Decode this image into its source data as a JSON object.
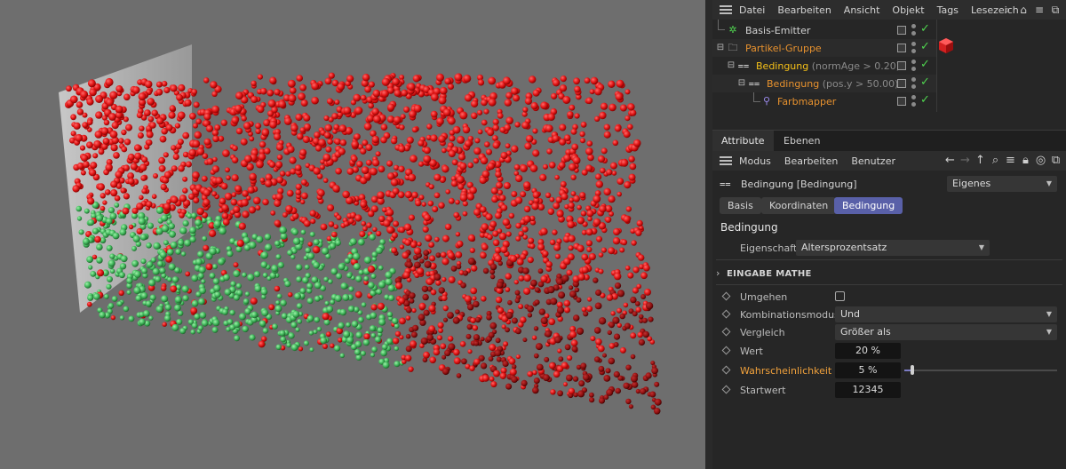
{
  "object_manager": {
    "menu": [
      "Datei",
      "Bearbeiten",
      "Ansicht",
      "Objekt",
      "Tags",
      "Lesezeich"
    ],
    "icons": [
      "search-icon",
      "home-icon",
      "filter-icon",
      "popout-icon"
    ],
    "objects": [
      {
        "name": "Basis-Emitter",
        "suffix": "",
        "name_color": "#d4d4d4",
        "icon": "emitter-icon",
        "icon_glyph": "✲",
        "icon_color": "#4fd24f"
      },
      {
        "name": "Partikel-Gruppe",
        "suffix": "",
        "name_color": "#e8922e",
        "icon": "folder-icon",
        "icon_glyph": "▭",
        "icon_color": "#cfcfcf"
      },
      {
        "name": "Bedingung",
        "suffix": "(normAge > 0.20)",
        "name_color": "#f5c018",
        "icon": "condition-icon",
        "icon_glyph": "≍",
        "icon_color": "#cfcfcf"
      },
      {
        "name": "Bedingung",
        "suffix": "(pos.y > 50.00)",
        "name_color": "#e8922e",
        "icon": "condition-icon",
        "icon_glyph": "≍",
        "icon_color": "#cfcfcf"
      },
      {
        "name": "Farbmapper",
        "suffix": "",
        "name_color": "#e8922e",
        "icon": "colormapper-icon",
        "icon_glyph": "⚲",
        "icon_color": "#9d8cf0"
      }
    ]
  },
  "attribute_manager": {
    "tabs": [
      "Attribute",
      "Ebenen"
    ],
    "toolbar_menu": [
      "Modus",
      "Bearbeiten",
      "Benutzer"
    ],
    "toolbar_icons": [
      "back-arrow-icon",
      "forward-arrow-icon",
      "up-arrow-icon",
      "search-icon",
      "filter-icon",
      "lock-icon",
      "target-icon",
      "popout-icon"
    ],
    "object_title": "Bedingung [Bedingung]",
    "mode_dropdown": "Eigenes",
    "subtabs": [
      "Basis",
      "Koordinaten",
      "Bedingung"
    ],
    "active_subtab": "Bedingung",
    "section_title": "Bedingung",
    "property": {
      "label": "Eigenschaft",
      "value": "Altersprozentsatz"
    },
    "group": "EINGABE MATHE",
    "params": {
      "bypass": {
        "label": "Umgehen",
        "checked": false
      },
      "combination": {
        "label": "Kombinationsmodus",
        "value": "Und"
      },
      "comparison": {
        "label": "Vergleich",
        "value": "Größer als"
      },
      "value": {
        "label": "Wert",
        "value": "20 %"
      },
      "probability": {
        "label": "Wahrscheinlichkeit",
        "value": "5 %",
        "fraction": 0.05
      },
      "seed": {
        "label": "Startwert",
        "value": "12345"
      }
    }
  },
  "viewport": {
    "background": "#6e6e6e",
    "particle_colors": {
      "red": "#e01414",
      "dark_red": "#8e1010",
      "green": "#3fb65a"
    }
  }
}
